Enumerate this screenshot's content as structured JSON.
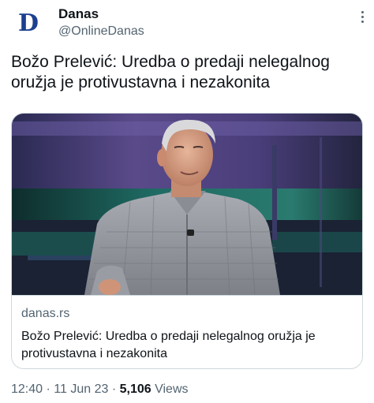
{
  "author": {
    "name": "Danas",
    "handle": "@OnlineDanas",
    "avatar_letter": "D"
  },
  "tweet": {
    "text": "Božo Prelević: Uredba o predaji nelegalnog oružja je protivustavna i nezakonita"
  },
  "card": {
    "domain": "danas.rs",
    "title": "Božo Prelević: Uredba o predaji nelegalnog oružja je protivustavna i nezakonita"
  },
  "meta": {
    "time": "12:40",
    "separator": "·",
    "date": "11 Jun 23",
    "views_count": "5,106",
    "views_label": "Views"
  },
  "colors": {
    "text_primary": "#0f1419",
    "text_secondary": "#536471",
    "border": "#cfd9de",
    "logo_blue": "#1c3f8f"
  },
  "icons": {
    "more": "more-dots-icon"
  }
}
